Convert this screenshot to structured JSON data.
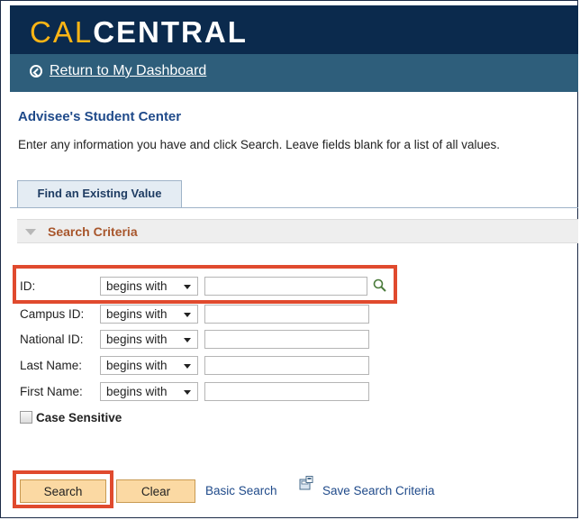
{
  "brand": {
    "part1": "CAL",
    "part2": "CENTRAL"
  },
  "return_link": "Return to My Dashboard",
  "page_title": "Advisee's Student Center",
  "instructions": "Enter any information you have and click Search. Leave fields blank for a list of all values.",
  "tab_label": "Find an Existing Value",
  "section_title": "Search Criteria",
  "fields": [
    {
      "label": "ID:",
      "operator": "begins with",
      "value": ""
    },
    {
      "label": "Campus ID:",
      "operator": "begins with",
      "value": ""
    },
    {
      "label": "National ID:",
      "operator": "begins with",
      "value": ""
    },
    {
      "label": "Last Name:",
      "operator": "begins with",
      "value": ""
    },
    {
      "label": "First Name:",
      "operator": "begins with",
      "value": ""
    }
  ],
  "case_sensitive_label": "Case Sensitive",
  "buttons": {
    "search": "Search",
    "clear": "Clear"
  },
  "links": {
    "basic_search": "Basic Search",
    "save_search": "Save Search Criteria"
  },
  "colors": {
    "brand_bg": "#0b2a4d",
    "brand_gold": "#fdb515",
    "bar_bg": "#2e5e7b",
    "highlight": "#e04a2e",
    "button_bg": "#fbd9a3"
  }
}
